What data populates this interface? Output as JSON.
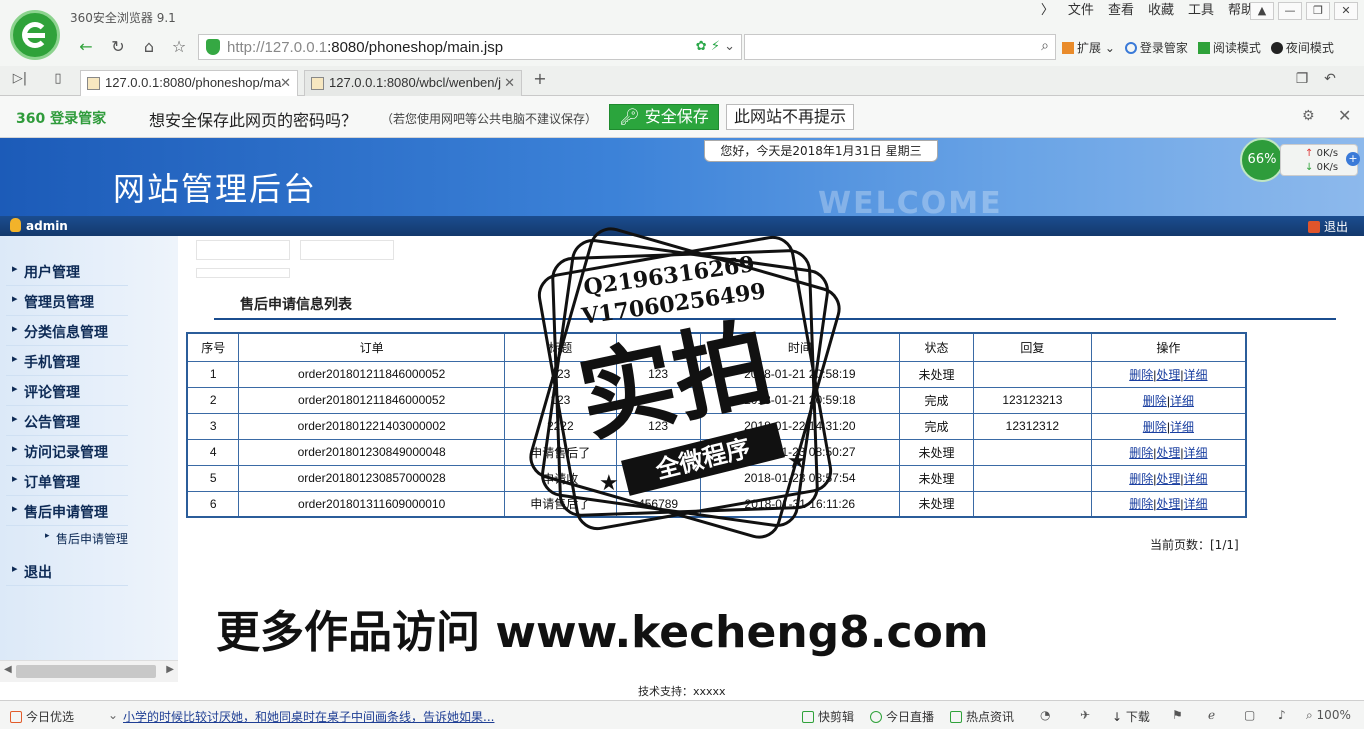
{
  "browser": {
    "app_title": "360安全浏览器 9.1",
    "menu": [
      "文件",
      "查看",
      "收藏",
      "工具",
      "帮助"
    ],
    "url_host": "http://127.0.0.1",
    "url_rest": ":8080/phoneshop/main.jsp",
    "tabs": [
      {
        "label": "127.0.0.1:8080/phoneshop/ma"
      },
      {
        "label": "127.0.0.1:8080/wbcl/wenben/j"
      }
    ],
    "right_tools": [
      "扩展",
      "登录管家",
      "阅读模式",
      "夜间模式"
    ],
    "password_bar": {
      "brand": "360 登录管家",
      "question": "想安全保存此网页的密码吗？",
      "note": "（若您使用网吧等公共电脑不建议保存）",
      "save": "安全保存",
      "never": "此网站不再提示"
    },
    "speed": {
      "percent": "66%",
      "up": "0K/s",
      "down": "0K/s"
    },
    "status": {
      "today": "今日优选",
      "news": "小学的时候比较讨厌她，和她同桌时在桌子中间画条线，告诉她如果...",
      "items": [
        "快剪辑",
        "今日直播",
        "热点资讯",
        "下载"
      ],
      "zoom": "100%"
    }
  },
  "site": {
    "title": "网站管理后台",
    "welcome": "WELCOME",
    "greeting": "您好，今天是2018年1月31日 星期三",
    "user": "admin",
    "logout": "退出",
    "sidebar": [
      "用户管理",
      "管理员管理",
      "分类信息管理",
      "手机管理",
      "评论管理",
      "公告管理",
      "访问记录管理",
      "订单管理",
      "售后申请管理"
    ],
    "sidebar_sub": "售后申请管理",
    "sidebar_exit": "退出",
    "section_title": "售后申请信息列表",
    "columns": [
      "序号",
      "订单",
      "标题",
      "",
      "时间",
      "状态",
      "回复",
      "操作"
    ],
    "rows": [
      {
        "no": "1",
        "order": "order201801211846000052",
        "title": "123",
        "content": "123",
        "time": "2018-01-21 20:58:19",
        "status": "未处理",
        "reply": "",
        "ops": [
          "删除",
          "处理",
          "详细"
        ]
      },
      {
        "no": "2",
        "order": "order201801211846000052",
        "title": "123",
        "content": "",
        "time": "2018-01-21 20:59:18",
        "status": "完成",
        "reply": "123123213",
        "ops": [
          "删除",
          "详细"
        ]
      },
      {
        "no": "3",
        "order": "order201801221403000002",
        "title": "2222",
        "content": "123",
        "time": "2018-01-22 14:31:20",
        "status": "完成",
        "reply": "12312312",
        "ops": [
          "删除",
          "详细"
        ]
      },
      {
        "no": "4",
        "order": "order201801230849000048",
        "title": "申请售后了",
        "content": "",
        "time": "2018-01-23 08:50:27",
        "status": "未处理",
        "reply": "",
        "ops": [
          "删除",
          "处理",
          "详细"
        ]
      },
      {
        "no": "5",
        "order": "order201801230857000028",
        "title": "申请收",
        "content": "",
        "time": "2018-01-23 08:57:54",
        "status": "未处理",
        "reply": "",
        "ops": [
          "删除",
          "处理",
          "详细"
        ]
      },
      {
        "no": "6",
        "order": "order201801311609000010",
        "title": "申请售后了",
        "content": "456789",
        "time": "2018-01-31 16:11:26",
        "status": "未处理",
        "reply": "",
        "ops": [
          "删除",
          "处理",
          "详细"
        ]
      }
    ],
    "page_info": "当前页数：[1/1]",
    "support": "技术支持：xxxxx"
  },
  "watermark": {
    "qq": "Q2196316269",
    "wx": "V17060256499",
    "big": "实拍",
    "ribbon": "全微程序",
    "promo": "更多作品访问 www.kecheng8.com"
  }
}
